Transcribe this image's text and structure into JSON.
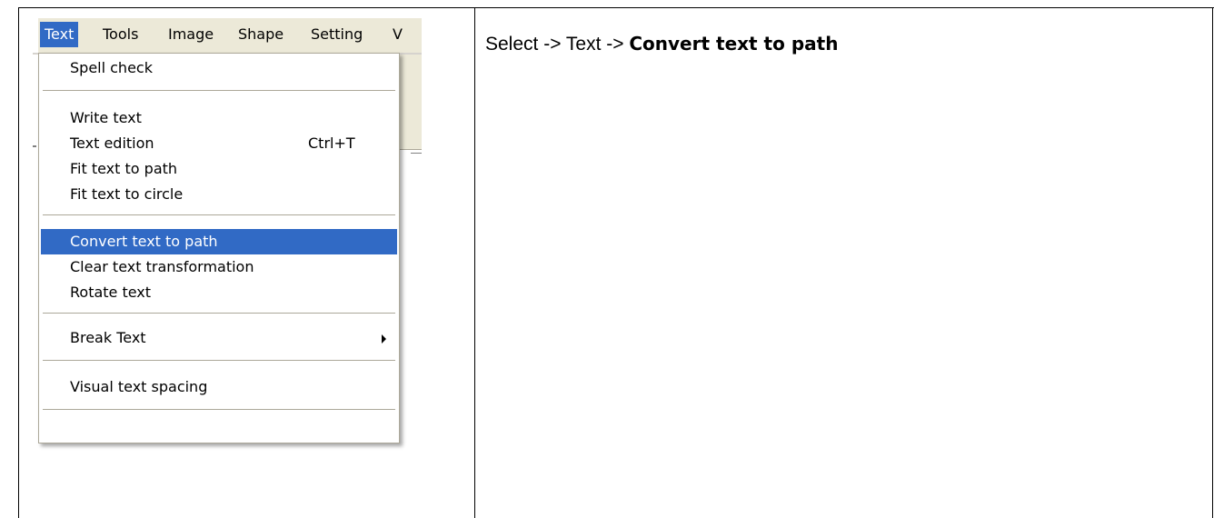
{
  "menubar": {
    "items": [
      {
        "label": "Text",
        "active": true
      },
      {
        "label": "Tools",
        "active": false
      },
      {
        "label": "Image",
        "active": false
      },
      {
        "label": "Shape",
        "active": false
      },
      {
        "label": "Setting",
        "active": false
      },
      {
        "label": "V",
        "active": false
      }
    ]
  },
  "menu": {
    "items": [
      {
        "label": "Spell check"
      },
      {
        "label": "Write text"
      },
      {
        "label": "Text edition",
        "shortcut": "Ctrl+T"
      },
      {
        "label": "Fit text to path"
      },
      {
        "label": "Fit text to circle"
      },
      {
        "label": "Convert text to path",
        "highlighted": true
      },
      {
        "label": "Clear text transformation"
      },
      {
        "label": "Rotate text"
      },
      {
        "label": "Break Text",
        "submenu_icon": "submenu-arrow-icon"
      },
      {
        "label": "Visual text spacing"
      }
    ]
  },
  "instruction": {
    "prefix": "Select -> Text -> ",
    "emphasis": "Convert text to path"
  },
  "colors": {
    "highlight": "#316ac5",
    "menu_bar_bg": "#ece9d8",
    "separator": "#aca899"
  }
}
